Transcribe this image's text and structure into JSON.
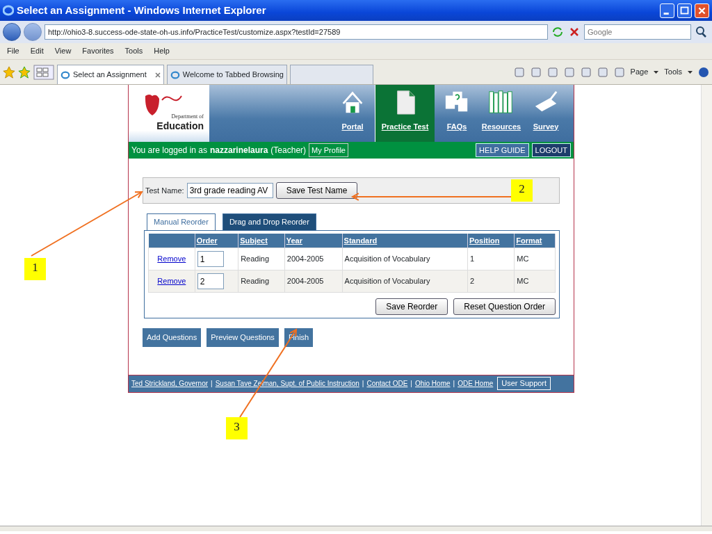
{
  "window": {
    "title": "Select an Assignment - Windows Internet Explorer"
  },
  "address_bar": {
    "url": "http://ohio3-8.success-ode-state-oh-us.info/PracticeTest/customize.aspx?testId=27589",
    "search_placeholder": "Google"
  },
  "menu": [
    "File",
    "Edit",
    "View",
    "Favorites",
    "Tools",
    "Help"
  ],
  "tabs": [
    {
      "label": "Select an Assignment",
      "selected": true
    },
    {
      "label": "Welcome to Tabbed Browsing",
      "selected": false
    }
  ],
  "command_bar": [
    "Page",
    "Tools"
  ],
  "site": {
    "logo": {
      "line1": "Department of",
      "line2": "Education"
    },
    "nav": [
      {
        "label": "Portal",
        "kind": "house",
        "selected": false
      },
      {
        "label": "Practice Test",
        "kind": "document",
        "selected": true
      },
      {
        "label": "FAQs",
        "kind": "questions",
        "selected": false
      },
      {
        "label": "Resources",
        "kind": "books",
        "selected": false
      },
      {
        "label": "Survey",
        "kind": "survey",
        "selected": false
      }
    ],
    "login": {
      "prefix": "You are logged in as",
      "user": "nazzarinelaura",
      "role": "(Teacher)",
      "profile": "My Profile"
    },
    "header_buttons": [
      "HELP GUIDE",
      "LOGOUT"
    ],
    "test_name": {
      "label": "Test Name:",
      "value": "3rd grade reading AV",
      "button": "Save Test Name"
    },
    "reorder_tabs": [
      {
        "label": "Manual Reorder",
        "selected": true
      },
      {
        "label": "Drag and Drop Reorder",
        "selected": false
      }
    ],
    "table": {
      "columns": [
        "",
        "Order",
        "Subject",
        "Year",
        "Standard",
        "Position",
        "Format"
      ],
      "rows": [
        {
          "cells": [
            "Remove",
            "1",
            "Reading",
            "2004-2005",
            "Acquisition of Vocabulary",
            "1",
            "MC"
          ]
        },
        {
          "cells": [
            "Remove",
            "2",
            "Reading",
            "2004-2005",
            "Acquisition of Vocabulary",
            "2",
            "MC"
          ]
        }
      ]
    },
    "table_buttons": [
      "Save Reorder",
      "Reset Question Order"
    ],
    "actions": [
      "Add Questions",
      "Preview Questions",
      "Finish"
    ],
    "footer_items": [
      {
        "kind": "link",
        "text": "Ted Strickland, Governor"
      },
      {
        "kind": "separator",
        "text": "|"
      },
      {
        "kind": "link",
        "text": "Susan Tave Zelman, Supt. of Public Instruction"
      },
      {
        "kind": "separator",
        "text": "|"
      },
      {
        "kind": "link",
        "text": "Contact ODE"
      },
      {
        "kind": "separator",
        "text": "|"
      },
      {
        "kind": "link",
        "text": "Ohio Home"
      },
      {
        "kind": "separator",
        "text": "|"
      },
      {
        "kind": "link",
        "text": "ODE Home"
      }
    ],
    "footer_button": "User Support"
  },
  "callouts": [
    "1",
    "2",
    "3"
  ]
}
